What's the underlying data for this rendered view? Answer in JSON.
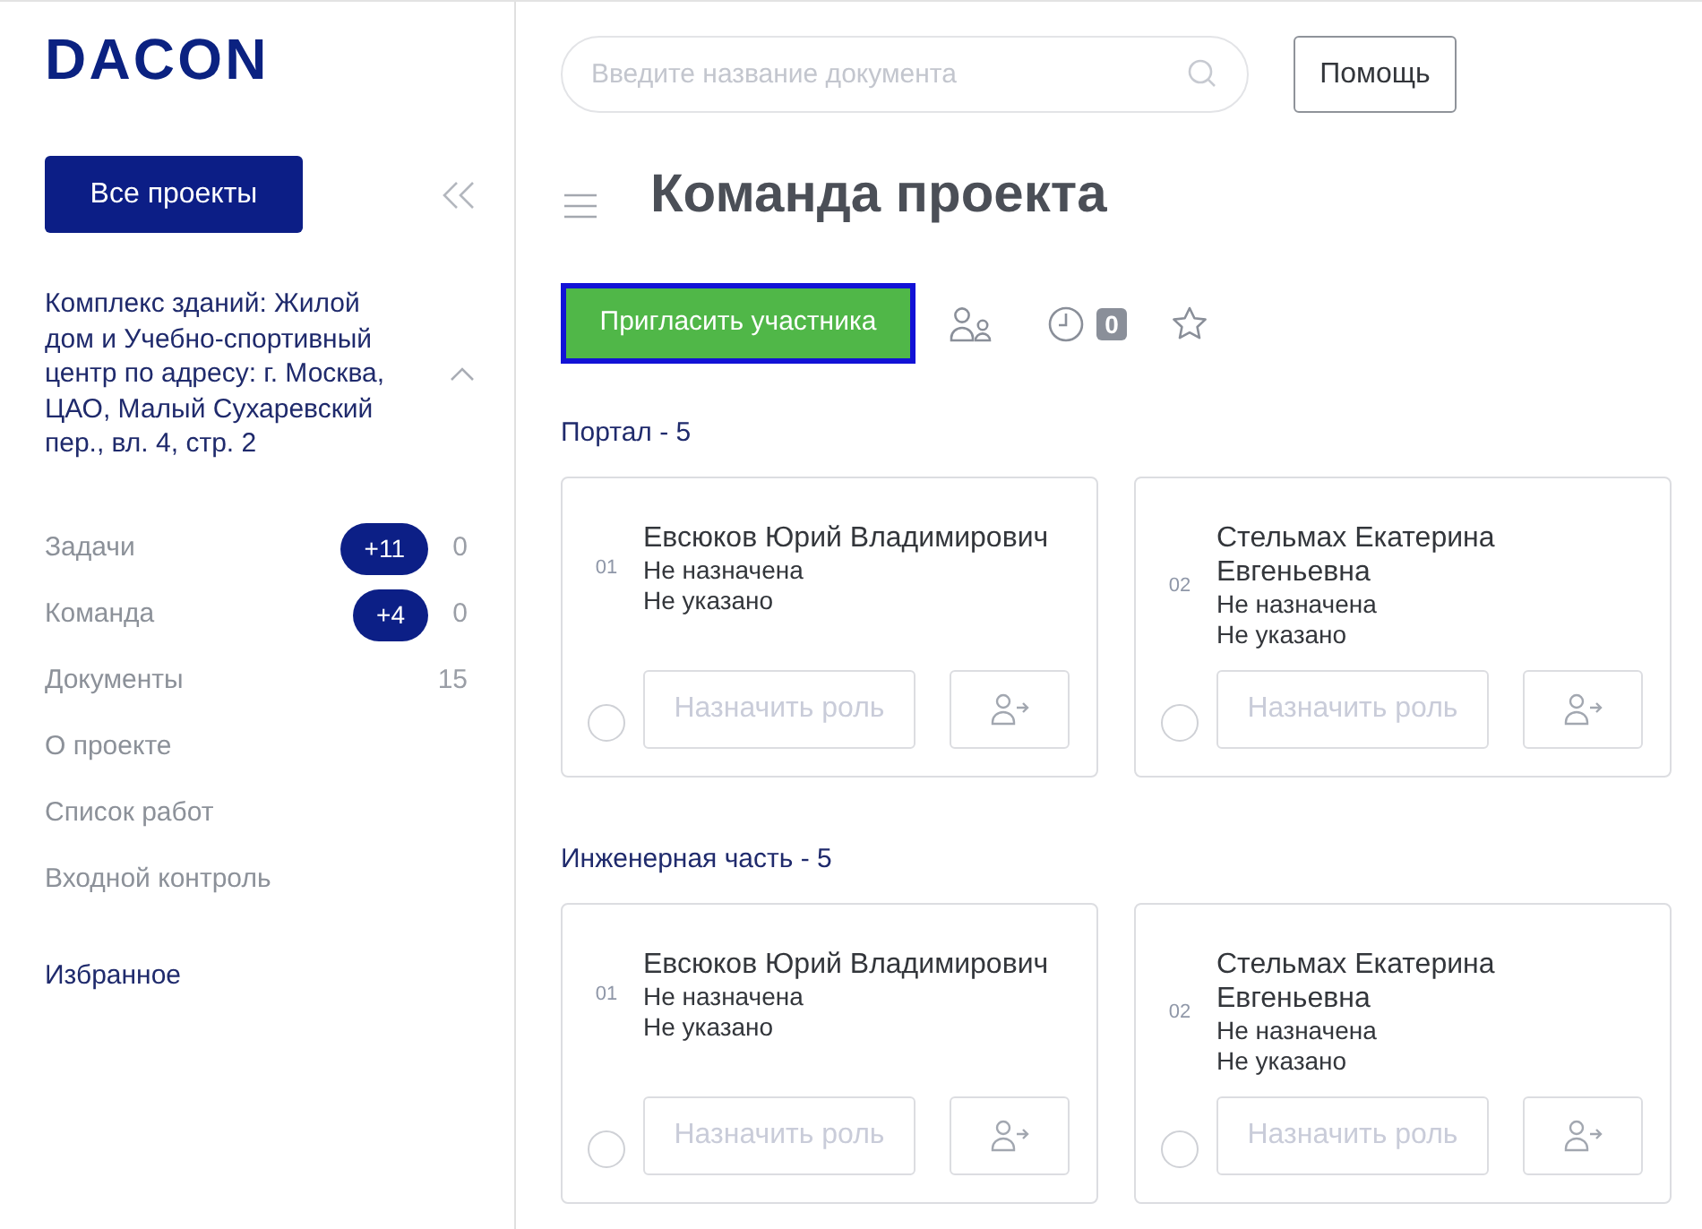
{
  "logo": "DACON",
  "sidebar": {
    "all_projects_button": "Все проекты",
    "project": {
      "name": "Комплекс зданий: Жилой дом и Учебно-спортивный центр по адресу: г. Москва, ЦАО, Малый Сухаревский пер., вл. 4, стр. 2",
      "expanded": true
    },
    "nav": [
      {
        "label": "Задачи",
        "badge": "+11",
        "count": "0"
      },
      {
        "label": "Команда",
        "badge": "+4",
        "count": "0"
      },
      {
        "label": "Документы",
        "count": "15"
      },
      {
        "label": "О проекте"
      },
      {
        "label": "Список работ"
      },
      {
        "label": "Входной контроль"
      }
    ],
    "favorites": "Избранное"
  },
  "search": {
    "placeholder": "Введите название документа"
  },
  "help_button": "Помощь",
  "page_title": "Команда проекта",
  "toolbar": {
    "invite_button": {
      "label": "Пригласить участника",
      "focused": true
    },
    "history_count": "0"
  },
  "sections": [
    {
      "title": "Портал - 5",
      "members": [
        {
          "number": "01",
          "name": "Евсюков Юрий Владимирович",
          "role": "Не назначена",
          "detail": "Не указано",
          "selected": false,
          "role_button": {
            "label": "Назначить роль",
            "disabled": true
          }
        },
        {
          "number": "02",
          "name": "Стельмах Екатерина Евгеньевна",
          "role": "Не назначена",
          "detail": "Не указано",
          "selected": false,
          "role_button": {
            "label": "Назначить роль",
            "disabled": true
          }
        }
      ]
    },
    {
      "title": "Инженерная часть - 5",
      "members": [
        {
          "number": "01",
          "name": "Евсюков Юрий Владимирович",
          "role": "Не назначена",
          "detail": "Не указано",
          "selected": false,
          "role_button": {
            "label": "Назначить роль",
            "disabled": true
          }
        },
        {
          "number": "02",
          "name": "Стельмах Екатерина Евгеньевна",
          "role": "Не назначена",
          "detail": "Не указано",
          "selected": false,
          "role_button": {
            "label": "Назначить роль",
            "disabled": true
          }
        }
      ]
    }
  ]
}
